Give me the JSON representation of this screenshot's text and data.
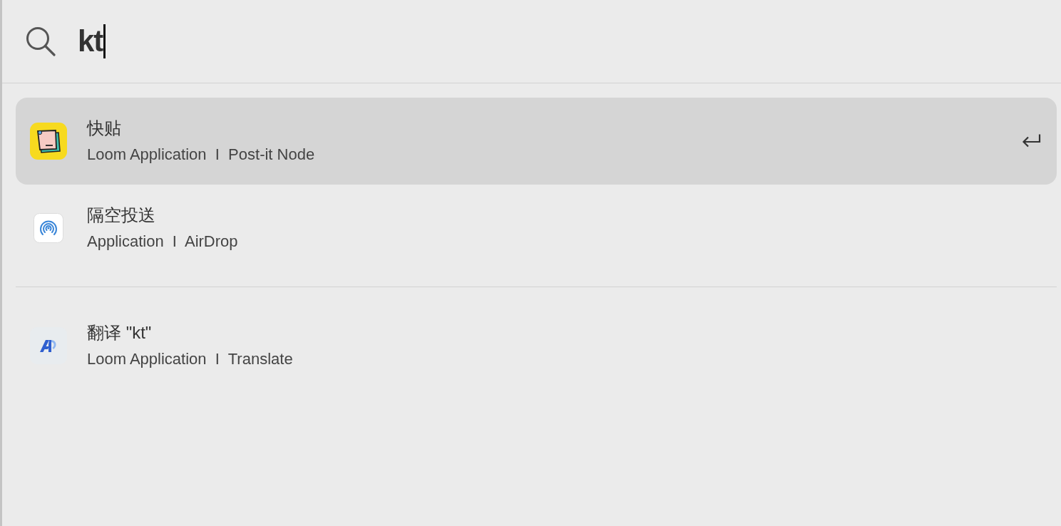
{
  "search": {
    "value": "kt"
  },
  "sections": [
    {
      "items": [
        {
          "kind": "sticky-note",
          "title": "快贴",
          "subtitle": "Loom Application  I  Post-it Node",
          "selected": true
        },
        {
          "kind": "rings",
          "title": "隔空投送",
          "subtitle": "Application  I  AirDrop",
          "selected": false
        }
      ]
    },
    {
      "items": [
        {
          "kind": "letter-a",
          "title": "翻译 \"kt\"",
          "subtitle": "Loom Application  I  Translate",
          "selected": false
        }
      ]
    }
  ]
}
